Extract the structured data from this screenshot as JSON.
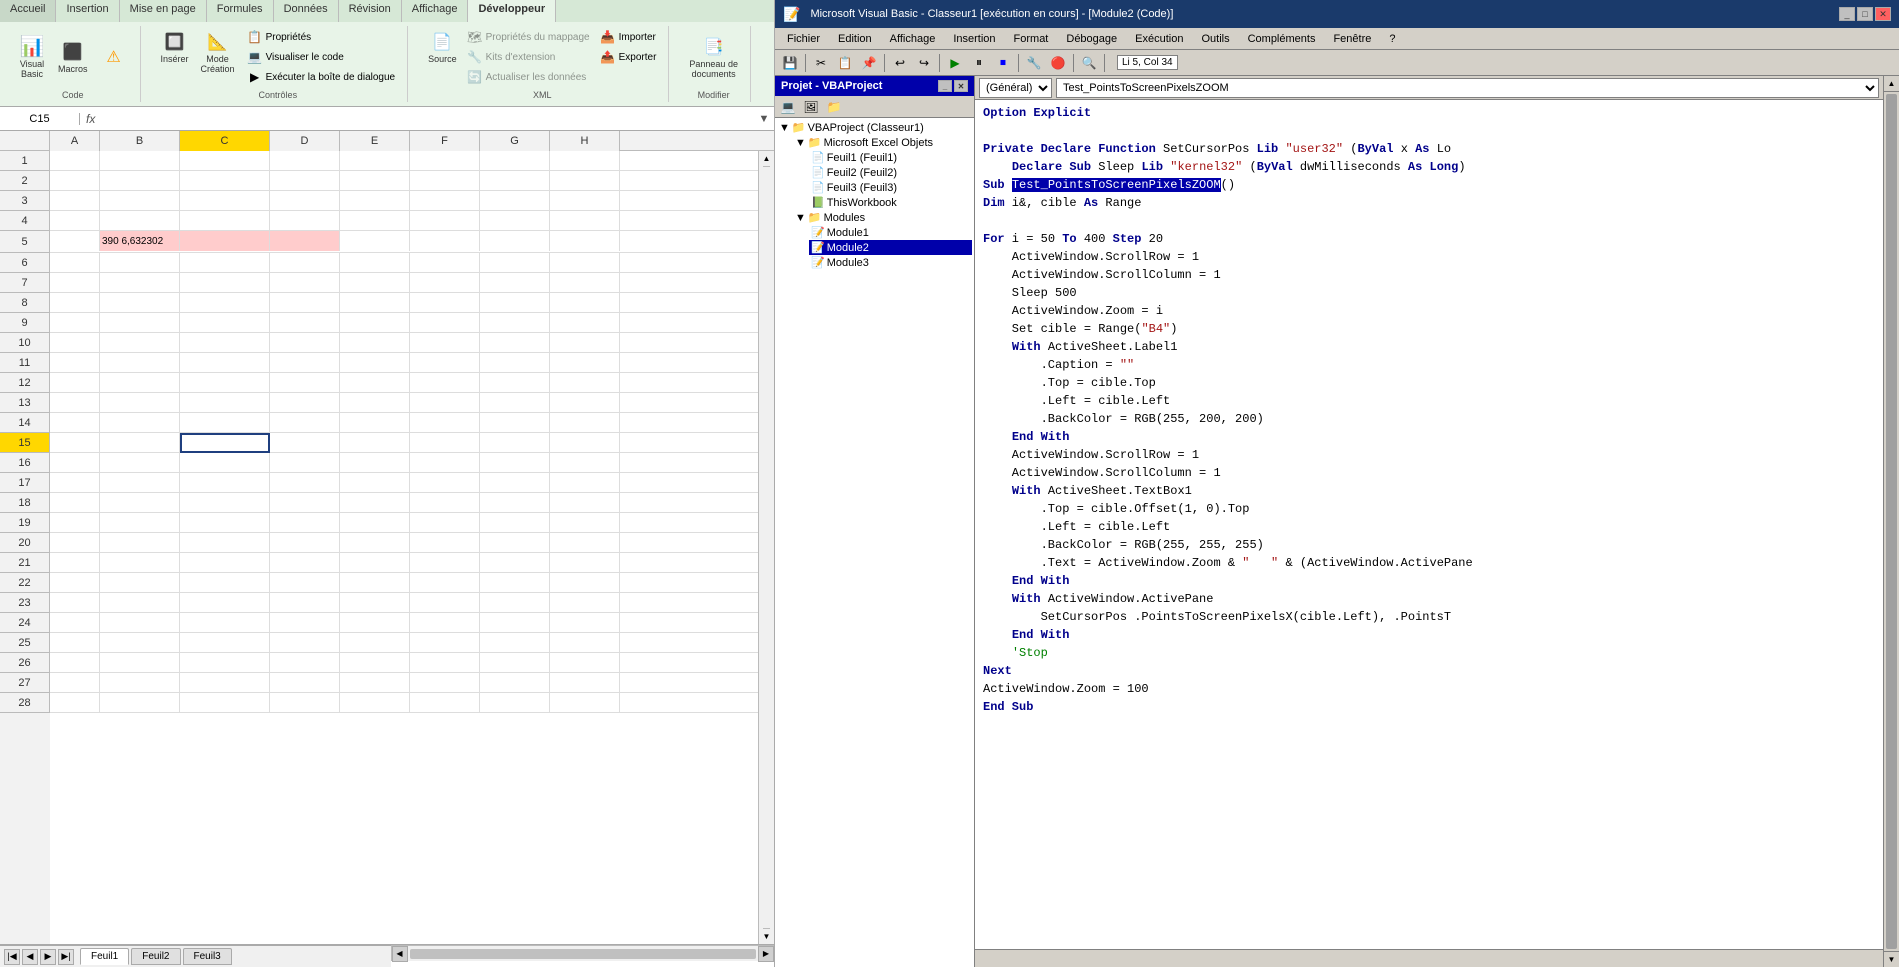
{
  "excel": {
    "ribbon_tabs": [
      "Accueil",
      "Insertion",
      "Mise en page",
      "Formules",
      "Données",
      "Révision",
      "Affichage",
      "Développeur"
    ],
    "active_tab": "Développeur",
    "groups": {
      "code": {
        "label": "Code",
        "buttons": [
          {
            "id": "visual-basic",
            "label": "Visual Basic",
            "icon": "📊"
          },
          {
            "id": "macros",
            "label": "Macros",
            "icon": "⬛"
          },
          {
            "id": "warning",
            "label": "",
            "icon": "⚠"
          }
        ]
      },
      "controls": {
        "label": "Contrôles",
        "buttons": [
          {
            "id": "inserer",
            "label": "Insérer",
            "icon": "🔲"
          },
          {
            "id": "mode-creation",
            "label": "Mode\nCréation",
            "icon": "📐"
          },
          {
            "id": "proprietes",
            "label": "Propriétés",
            "icon": "📋"
          },
          {
            "id": "visualiser",
            "label": "Visualiser le code",
            "icon": "💻"
          },
          {
            "id": "executer",
            "label": "Exécuter la boîte de dialogue",
            "icon": "▶"
          }
        ]
      },
      "xml": {
        "label": "XML",
        "buttons": [
          {
            "id": "proprietes-map",
            "label": "Propriétés du mappage",
            "icon": "🗺",
            "disabled": true
          },
          {
            "id": "kits",
            "label": "Kits d'extension",
            "icon": "🔧",
            "disabled": true
          },
          {
            "id": "actualiser",
            "label": "Actualiser les données",
            "icon": "🔄",
            "disabled": true
          },
          {
            "id": "source",
            "label": "Source",
            "icon": "📄"
          },
          {
            "id": "importer",
            "label": "Importer",
            "icon": "📥"
          },
          {
            "id": "exporter",
            "label": "Exporter",
            "icon": "📤"
          }
        ]
      },
      "modifier": {
        "label": "Modifier",
        "buttons": [
          {
            "id": "panneau",
            "label": "Panneau de\ndocuments",
            "icon": "📑"
          }
        ]
      }
    },
    "formula_bar": {
      "cell_ref": "C15",
      "formula": ""
    },
    "columns": [
      "A",
      "B",
      "C",
      "D",
      "E",
      "F",
      "G",
      "H"
    ],
    "rows": 28,
    "cells": {
      "B5": {
        "value": "390  6,632302",
        "bg": "pink"
      },
      "C5": {
        "value": "",
        "bg": "pink"
      },
      "D5": {
        "value": "",
        "bg": "pink"
      },
      "C15": {
        "value": "",
        "selected": true
      }
    },
    "sheet_tabs": [
      "Feuil1",
      "Feuil2",
      "Feuil3"
    ]
  },
  "vba": {
    "title": "Microsoft Visual Basic - Classeur1 [exécution en cours] - [Module2 (Code)]",
    "menubar": [
      "Fichier",
      "Edition",
      "Affichage",
      "Insertion",
      "Format",
      "Débogage",
      "Exécution",
      "Outils",
      "Compléments",
      "Fenêtre",
      "?"
    ],
    "position": "Li 5, Col 34",
    "project": {
      "title": "Projet - VBAProject",
      "tree": {
        "root": "VBAProject (Classeur1)",
        "items": [
          {
            "label": "Microsoft Excel Objets",
            "type": "folder"
          },
          {
            "label": "Feuil1 (Feuil1)",
            "type": "sheet",
            "indent": 1
          },
          {
            "label": "Feuil2 (Feuil2)",
            "type": "sheet",
            "indent": 1
          },
          {
            "label": "Feuil3 (Feuil3)",
            "type": "sheet",
            "indent": 1
          },
          {
            "label": "ThisWorkbook",
            "type": "workbook",
            "indent": 1
          },
          {
            "label": "Modules",
            "type": "folder"
          },
          {
            "label": "Module1",
            "type": "module",
            "indent": 1
          },
          {
            "label": "Module2",
            "type": "module",
            "indent": 1,
            "selected": true
          },
          {
            "label": "Module3",
            "type": "module",
            "indent": 1
          }
        ]
      }
    },
    "code_dropdowns": {
      "left": "(Général)",
      "right": "Test_PointsToScreenPixelsZOOM"
    },
    "code_lines": [
      {
        "type": "normal",
        "text": "Option Explicit"
      },
      {
        "type": "blank",
        "text": ""
      },
      {
        "type": "mixed",
        "parts": [
          {
            "type": "keyword",
            "text": "Private Declare Function"
          },
          {
            "type": "normal",
            "text": " SetCursorPos "
          },
          {
            "type": "keyword",
            "text": "Lib"
          },
          {
            "type": "string",
            "text": " \"user32\""
          },
          {
            "type": "normal",
            "text": " ("
          },
          {
            "type": "keyword",
            "text": "ByVal"
          },
          {
            "type": "normal",
            "text": " x "
          },
          {
            "type": "keyword",
            "text": "As"
          },
          {
            "type": "normal",
            "text": " Lo"
          }
        ]
      },
      {
        "type": "mixed",
        "parts": [
          {
            "type": "keyword",
            "text": "    Declare Sub"
          },
          {
            "type": "normal",
            "text": " Sleep "
          },
          {
            "type": "keyword",
            "text": "Lib"
          },
          {
            "type": "string",
            "text": " \"kernel32\""
          },
          {
            "type": "normal",
            "text": " ("
          },
          {
            "type": "keyword",
            "text": "ByVal"
          },
          {
            "type": "normal",
            "text": " dwMilliseconds "
          },
          {
            "type": "keyword",
            "text": "As Long"
          },
          {
            "type": "normal",
            "text": ")"
          }
        ]
      },
      {
        "type": "mixed",
        "parts": [
          {
            "type": "keyword",
            "text": "Sub"
          },
          {
            "type": "normal",
            "text": " "
          },
          {
            "type": "highlight",
            "text": "Test_PointsToScreenPixelsZOOM"
          },
          {
            "type": "normal",
            "text": "()"
          }
        ]
      },
      {
        "type": "mixed",
        "parts": [
          {
            "type": "keyword",
            "text": "Dim"
          },
          {
            "type": "normal",
            "text": " i&, cible "
          },
          {
            "type": "keyword",
            "text": "As"
          },
          {
            "type": "normal",
            "text": " Range"
          }
        ]
      },
      {
        "type": "blank",
        "text": ""
      },
      {
        "type": "mixed",
        "parts": [
          {
            "type": "keyword",
            "text": "For"
          },
          {
            "type": "normal",
            "text": " i = 50 "
          },
          {
            "type": "keyword",
            "text": "To"
          },
          {
            "type": "normal",
            "text": " 400 "
          },
          {
            "type": "keyword",
            "text": "Step"
          },
          {
            "type": "normal",
            "text": " 20"
          }
        ]
      },
      {
        "type": "normal",
        "text": "    ActiveWindow.ScrollRow = 1"
      },
      {
        "type": "normal",
        "text": "    ActiveWindow.ScrollColumn = 1"
      },
      {
        "type": "normal",
        "text": "    Sleep 500"
      },
      {
        "type": "normal",
        "text": "    ActiveWindow.Zoom = i"
      },
      {
        "type": "normal",
        "text": "    Set cible = Range(\"B4\")"
      },
      {
        "type": "mixed",
        "parts": [
          {
            "type": "keyword",
            "text": "    With"
          },
          {
            "type": "normal",
            "text": " ActiveSheet.Label1"
          }
        ]
      },
      {
        "type": "string",
        "text": "        .Caption = \"\""
      },
      {
        "type": "normal",
        "text": "        .Top = cible.Top"
      },
      {
        "type": "normal",
        "text": "        .Left = cible.Left"
      },
      {
        "type": "normal",
        "text": "        .BackColor = RGB(255, 200, 200)"
      },
      {
        "type": "mixed",
        "parts": [
          {
            "type": "keyword",
            "text": "    End With"
          }
        ]
      },
      {
        "type": "normal",
        "text": "    ActiveWindow.ScrollRow = 1"
      },
      {
        "type": "normal",
        "text": "    ActiveWindow.ScrollColumn = 1"
      },
      {
        "type": "mixed",
        "parts": [
          {
            "type": "keyword",
            "text": "    With"
          },
          {
            "type": "normal",
            "text": " ActiveSheet.TextBox1"
          }
        ]
      },
      {
        "type": "normal",
        "text": "        .Top = cible.Offset(1, 0).Top"
      },
      {
        "type": "normal",
        "text": "        .Left = cible.Left"
      },
      {
        "type": "normal",
        "text": "        .BackColor = RGB(255, 255, 255)"
      },
      {
        "type": "normal",
        "text": "        .Text = ActiveWindow.Zoom & \"   \" & (ActiveWindow.ActivePane"
      },
      {
        "type": "mixed",
        "parts": [
          {
            "type": "keyword",
            "text": "    End With"
          }
        ]
      },
      {
        "type": "mixed",
        "parts": [
          {
            "type": "keyword",
            "text": "    With"
          },
          {
            "type": "normal",
            "text": " ActiveWindow.ActivePane"
          }
        ]
      },
      {
        "type": "normal",
        "text": "        SetCursorPos .PointsToScreenPixelsX(cible.Left), .PointsT"
      },
      {
        "type": "mixed",
        "parts": [
          {
            "type": "keyword",
            "text": "    End With"
          }
        ]
      },
      {
        "type": "comment",
        "text": "    'Stop"
      },
      {
        "type": "mixed",
        "parts": [
          {
            "type": "keyword",
            "text": "Next"
          }
        ]
      },
      {
        "type": "normal",
        "text": "ActiveWindow.Zoom = 100"
      },
      {
        "type": "mixed",
        "parts": [
          {
            "type": "keyword",
            "text": "End Sub"
          }
        ]
      }
    ]
  }
}
